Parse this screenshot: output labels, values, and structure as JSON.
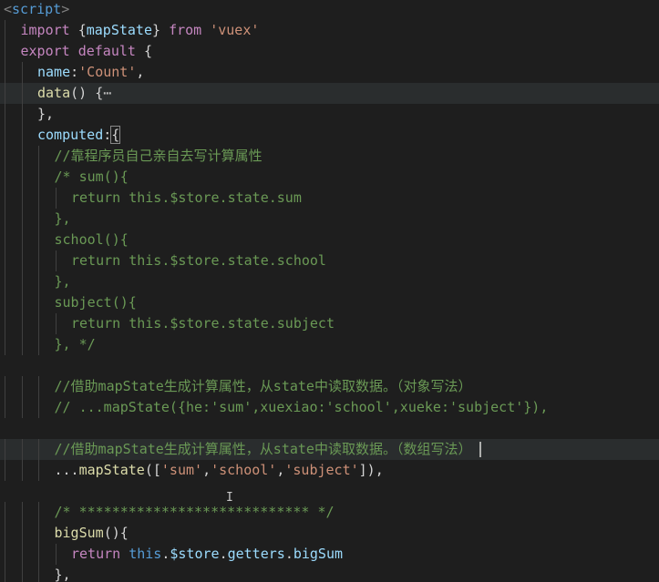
{
  "colors": {
    "background": "#1e1e1e",
    "current_line": "#2a2d2e",
    "keyword": "#c586c0",
    "control_keyword": "#c586c0",
    "string": "#ce9178",
    "comment": "#6a9955",
    "function": "#dcdcaa",
    "variable": "#9cdcfe",
    "this": "#569cd6",
    "punctuation": "#d4d4d4",
    "tag": "#569cd6",
    "tag_bracket": "#808080",
    "fold": "#c0c0c0"
  },
  "editor": {
    "language": "vue",
    "lines": [
      {
        "indent": 0,
        "tokens": [
          [
            "<",
            "tag_bracket"
          ],
          [
            "script",
            "tag"
          ],
          [
            ">",
            "tag_bracket"
          ]
        ]
      },
      {
        "indent": 1,
        "tokens": [
          [
            "import",
            "keyword"
          ],
          [
            " {",
            "punctuation"
          ],
          [
            "mapState",
            "variable"
          ],
          [
            "} ",
            "punctuation"
          ],
          [
            "from",
            "keyword"
          ],
          [
            " ",
            "punctuation"
          ],
          [
            "'vuex'",
            "string"
          ]
        ]
      },
      {
        "indent": 1,
        "tokens": [
          [
            "export",
            "keyword"
          ],
          [
            " ",
            "punctuation"
          ],
          [
            "default",
            "keyword"
          ],
          [
            " {",
            "punctuation"
          ]
        ]
      },
      {
        "indent": 2,
        "tokens": [
          [
            "name",
            "variable"
          ],
          [
            ":",
            "punctuation"
          ],
          [
            "'Count'",
            "string"
          ],
          [
            ",",
            "punctuation"
          ]
        ]
      },
      {
        "indent": 2,
        "current": true,
        "tokens": [
          [
            "data",
            "function"
          ],
          [
            "() {",
            "punctuation"
          ],
          [
            "⋯",
            "fold"
          ]
        ]
      },
      {
        "indent": 2,
        "tokens": [
          [
            "},",
            "punctuation"
          ]
        ]
      },
      {
        "indent": 2,
        "tokens": [
          [
            "computed",
            "variable"
          ],
          [
            ":",
            "punctuation"
          ],
          [
            "{",
            "punctuation",
            "bracket"
          ]
        ]
      },
      {
        "indent": 3,
        "tokens": [
          [
            "//靠程序员自己亲自去写计算属性",
            "comment"
          ]
        ]
      },
      {
        "indent": 3,
        "tokens": [
          [
            "/* sum(){",
            "comment"
          ]
        ]
      },
      {
        "indent": 4,
        "tokens": [
          [
            "return this.$store.state.sum",
            "comment"
          ]
        ]
      },
      {
        "indent": 3,
        "tokens": [
          [
            "},",
            "comment"
          ]
        ]
      },
      {
        "indent": 3,
        "tokens": [
          [
            "school(){",
            "comment"
          ]
        ]
      },
      {
        "indent": 4,
        "tokens": [
          [
            "return this.$store.state.school",
            "comment"
          ]
        ]
      },
      {
        "indent": 3,
        "tokens": [
          [
            "},",
            "comment"
          ]
        ]
      },
      {
        "indent": 3,
        "tokens": [
          [
            "subject(){",
            "comment"
          ]
        ]
      },
      {
        "indent": 4,
        "tokens": [
          [
            "return this.$store.state.subject",
            "comment"
          ]
        ]
      },
      {
        "indent": 3,
        "tokens": [
          [
            "}, */",
            "comment"
          ]
        ]
      },
      {
        "indent": 0,
        "tokens": []
      },
      {
        "indent": 3,
        "tokens": [
          [
            "//借助mapState生成计算属性，从state中读取数据。（对象写法）",
            "comment"
          ]
        ]
      },
      {
        "indent": 3,
        "tokens": [
          [
            "// ...mapState({he:'sum',xuexiao:'school',xueke:'subject'}),",
            "comment"
          ]
        ]
      },
      {
        "indent": 0,
        "tokens": []
      },
      {
        "indent": 3,
        "current": true,
        "caret": true,
        "tokens": [
          [
            "//借助mapState生成计算属性，从state中读取数据。（数组写法）",
            "comment"
          ]
        ]
      },
      {
        "indent": 3,
        "tokens": [
          [
            "...",
            "punctuation"
          ],
          [
            "mapState",
            "function"
          ],
          [
            "([",
            "punctuation"
          ],
          [
            "'sum'",
            "string"
          ],
          [
            ",",
            "punctuation"
          ],
          [
            "'school'",
            "string"
          ],
          [
            ",",
            "punctuation"
          ],
          [
            "'subject'",
            "string"
          ],
          [
            "]),",
            "punctuation"
          ]
        ]
      },
      {
        "indent": 0,
        "tokens": []
      },
      {
        "indent": 3,
        "tokens": [
          [
            "/* **************************** */",
            "comment"
          ]
        ]
      },
      {
        "indent": 3,
        "tokens": [
          [
            "bigSum",
            "function"
          ],
          [
            "(){",
            "punctuation"
          ]
        ]
      },
      {
        "indent": 4,
        "tokens": [
          [
            "return",
            "control_keyword"
          ],
          [
            " ",
            "punctuation"
          ],
          [
            "this",
            "this"
          ],
          [
            ".",
            "punctuation"
          ],
          [
            "$store",
            "variable"
          ],
          [
            ".",
            "punctuation"
          ],
          [
            "getters",
            "variable"
          ],
          [
            ".",
            "punctuation"
          ],
          [
            "bigSum",
            "variable"
          ]
        ]
      },
      {
        "indent": 3,
        "tokens": [
          [
            "},",
            "punctuation"
          ]
        ]
      }
    ]
  }
}
